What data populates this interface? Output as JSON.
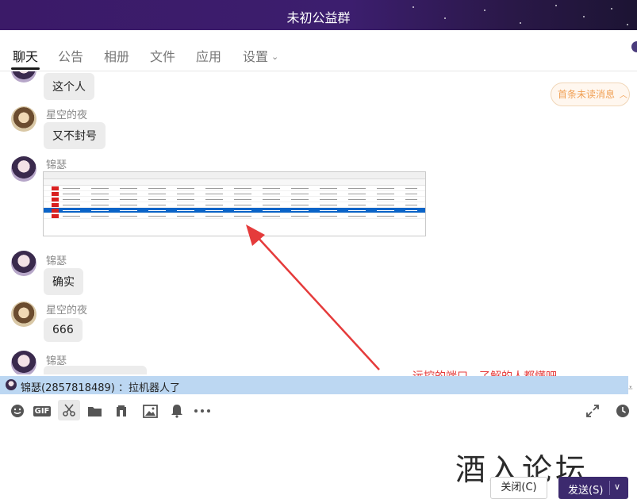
{
  "window": {
    "title": "未初公益群"
  },
  "tabs": [
    {
      "label": "聊天",
      "active": true
    },
    {
      "label": "公告"
    },
    {
      "label": "相册"
    },
    {
      "label": "文件"
    },
    {
      "label": "应用"
    },
    {
      "label": "设置"
    }
  ],
  "chat": {
    "unread_label": "首条未读消息",
    "messages": [
      {
        "sender": "",
        "text": "这个人",
        "avatar": "anime-avatar"
      },
      {
        "sender": "星空的夜",
        "text": "又不封号",
        "avatar": "character-avatar"
      },
      {
        "sender": "锦瑟",
        "text": "",
        "avatar": "anime-avatar",
        "image": "remote-control-screenshot"
      },
      {
        "sender": "锦瑟",
        "text": "确实",
        "avatar": "anime-avatar"
      },
      {
        "sender": "星空的夜",
        "text": "666",
        "avatar": "character-avatar"
      },
      {
        "sender": "锦瑟",
        "text": "",
        "avatar": "anime-avatar"
      }
    ]
  },
  "annotation": {
    "text": "远控的端口，了解的人都懂吧",
    "color": "#e53b3b"
  },
  "notification": {
    "text": "锦瑟(2857818489) ：拉机器人了"
  },
  "toolbar": {
    "icons": [
      "emoji-icon",
      "gif-icon",
      "scissors-icon",
      "folder-icon",
      "music-icon",
      "image-icon",
      "bell-icon",
      "more-icon"
    ],
    "right_icons": [
      "expand-icon",
      "history-clock-icon"
    ],
    "gif_label": "GIF"
  },
  "input": {
    "watermark": "酒入论坛",
    "close_label": "关闭(C)",
    "send_label": "发送(S)"
  },
  "colors": {
    "brand": "#3c2a6e",
    "notify_bg": "#bcd7f2",
    "unread_text": "#f0a054"
  }
}
